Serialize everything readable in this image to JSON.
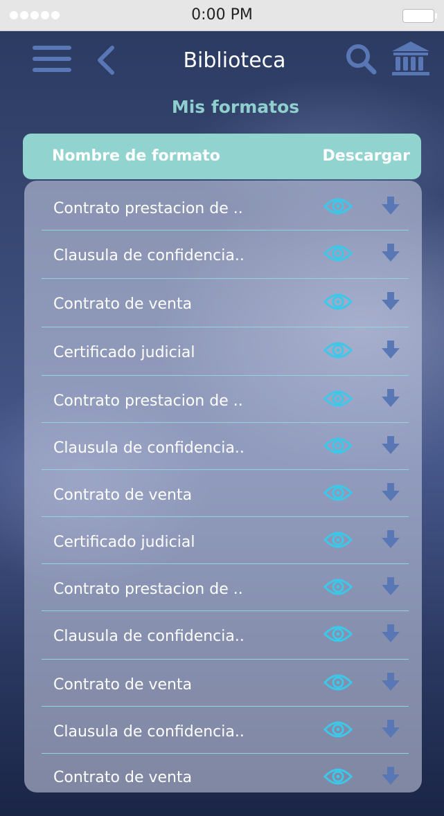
{
  "status_bar": {
    "time": "0:00 PM"
  },
  "navbar": {
    "title": "Biblioteca",
    "icons": [
      "menu-icon",
      "back-chevron-icon",
      "search-icon",
      "bank-icon"
    ]
  },
  "subtitle": "Mis formatos",
  "table": {
    "col_name": "Nombre de formato",
    "col_download": "Descargar",
    "rows": [
      "Contrato prestacion de ..",
      "Clausula de confidencia..",
      "Contrato de venta",
      "Certificado judicial",
      "Contrato prestacion de ..",
      "Clausula de confidencia..",
      "Contrato de venta",
      "Certificado judicial",
      "Contrato prestacion de ..",
      "Clausula de confidencia..",
      "Contrato de venta",
      "Clausula de confidencia..",
      "Contrato de venta"
    ],
    "row_icons": [
      "eye-icon",
      "download-arrow-icon"
    ]
  },
  "colors": {
    "accent": "#90d3cf",
    "icon_blue": "#5a77b5",
    "eye_cyan": "#3cc8e8"
  }
}
